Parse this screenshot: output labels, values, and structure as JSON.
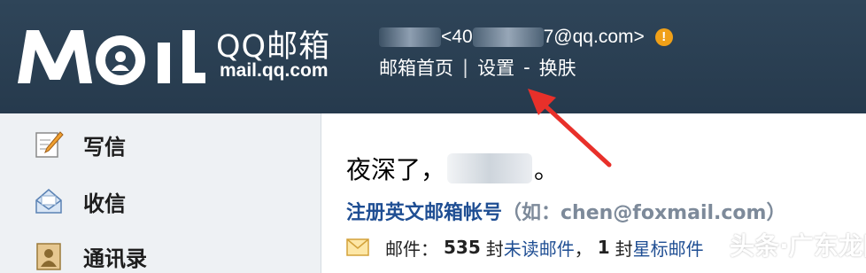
{
  "logo": {
    "mark_text": "Moil",
    "brand": "QQ邮箱",
    "url": "mail.qq.com"
  },
  "account": {
    "text_a": "<40",
    "text_b": "7@qq.com>",
    "warning_glyph": "!"
  },
  "topnav": {
    "home": "邮箱首页",
    "separator": "|",
    "settings": "设置",
    "dash": "-",
    "skin": "换肤"
  },
  "sidebar": {
    "items": [
      {
        "label": "写信",
        "icon": "pencil-icon"
      },
      {
        "label": "收信",
        "icon": "inbox-icon"
      },
      {
        "label": "通讯录",
        "icon": "contacts-icon"
      }
    ]
  },
  "main": {
    "greeting_prefix": "夜深了，",
    "greeting_suffix": "。",
    "register_link": "注册英文邮箱帐号",
    "register_hint": "（如：chen@foxmail.com）",
    "mail_label": "邮件：",
    "mail_count": "535",
    "unit1": "封",
    "unread_link": "未读邮件",
    "sep": "，",
    "star_count": "1",
    "unit2": "封",
    "star_link": "星标邮件"
  },
  "watermark": "头条·广东龙网"
}
